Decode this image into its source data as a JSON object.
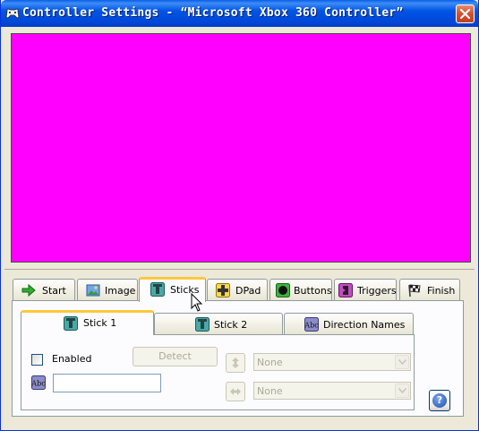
{
  "window": {
    "title": "Controller Settings - “Microsoft Xbox 360 Controller”",
    "title_icon": "gamepad-icon",
    "close_icon": "close-icon"
  },
  "preview": {
    "background_color": "#ff00ff"
  },
  "tabs": [
    {
      "label": "Start",
      "icon": "arrow-right-icon",
      "active": false
    },
    {
      "label": "Image",
      "icon": "picture-icon",
      "active": false
    },
    {
      "label": "Sticks",
      "icon": "stick-icon",
      "active": true
    },
    {
      "label": "DPad",
      "icon": "dpad-icon",
      "active": false
    },
    {
      "label": "Buttons",
      "icon": "button-icon",
      "active": false
    },
    {
      "label": "Triggers",
      "icon": "trigger-icon",
      "active": false
    },
    {
      "label": "Finish",
      "icon": "checkered-flag-icon",
      "active": false
    }
  ],
  "subtabs": [
    {
      "label": "Stick 1",
      "icon": "stick-icon",
      "active": true
    },
    {
      "label": "Stick 2",
      "icon": "stick-icon",
      "active": false
    },
    {
      "label": "Direction Names",
      "icon": "abc-icon",
      "active": false
    }
  ],
  "stick_panel": {
    "enabled_label": "Enabled",
    "enabled_checked": false,
    "detect_label": "Detect",
    "name_value": "",
    "vertical_axis_value": "None",
    "horizontal_axis_value": "None"
  },
  "help": {
    "label": "?"
  },
  "colors": {
    "accent": "#ffc83c",
    "titlebar": "#0055e5",
    "face": "#ece9d8"
  }
}
